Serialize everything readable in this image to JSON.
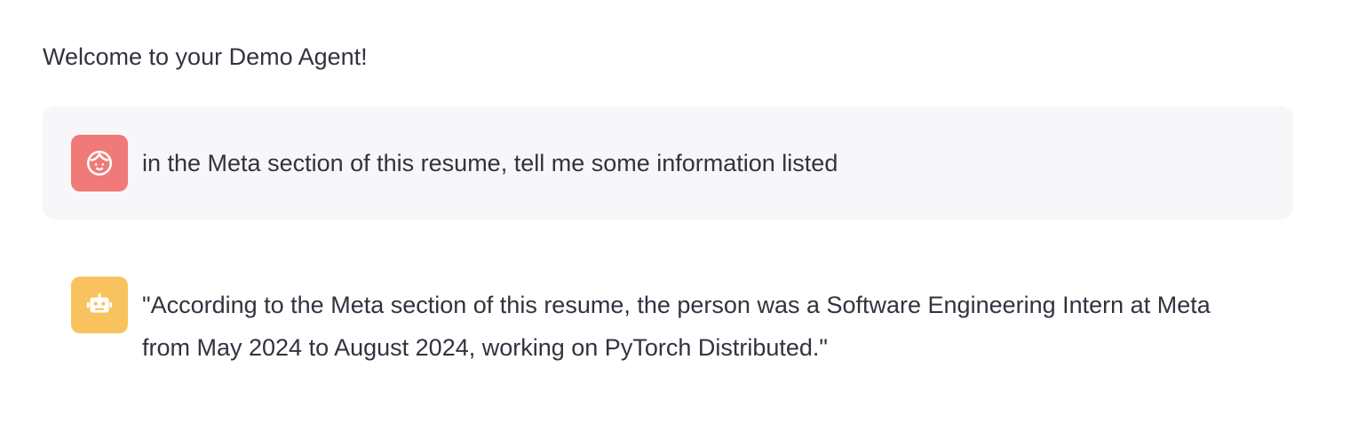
{
  "header": {
    "welcome": "Welcome to your Demo Agent!"
  },
  "messages": [
    {
      "role": "user",
      "avatar_icon": "user-face-icon",
      "text": "in the Meta section of this resume, tell me some information listed"
    },
    {
      "role": "assistant",
      "avatar_icon": "robot-icon",
      "text": "\"According to the Meta section of this resume, the person was a Software Engineering Intern at Meta from May 2024 to August 2024, working on PyTorch Distributed.\""
    }
  ],
  "colors": {
    "user_avatar": "#f07a78",
    "bot_avatar": "#f8c35f",
    "user_bubble": "#f7f7f9",
    "text": "#31333f"
  }
}
